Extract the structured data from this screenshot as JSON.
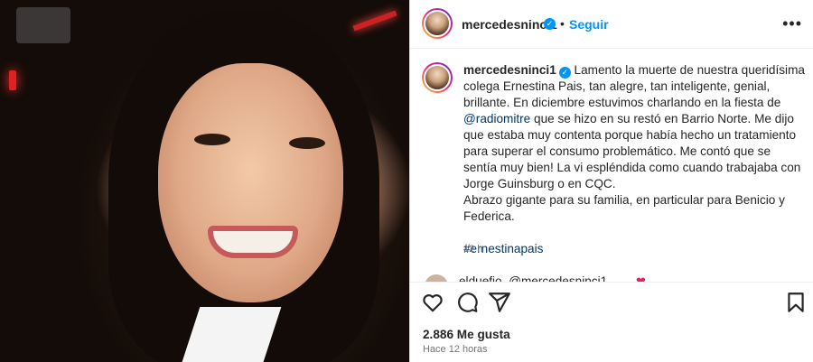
{
  "post": {
    "username": "mercedesninci1",
    "follow_label": "Seguir",
    "more_label": "•••",
    "dot": "•",
    "verified_mark": "✓"
  },
  "caption": {
    "username": "mercedesninci1",
    "text_before_mention": "Lamento la muerte de nuestra queridísima colega Ernestina Pais, tan alegre, tan inteligente, genial, brillante. En diciembre estuvimos charlando en la fiesta de",
    "mention": "@radiomitre",
    "text_after_mention": "que se hizo en su restó en Barrio Norte. Me dijo que estaba muy contenta porque había hecho un tratamiento para superar el consumo problemático. Me contó que se sentía muy bien! La vi espléndida como cuando trabajaba con Jorge Guinsburg o en CQC.",
    "closing": "Abrazo gigante para su familia, en particular para Benicio y Federica.",
    "hashtag": "#ernestinapais",
    "time_ago": "12 h"
  },
  "comment_peek": {
    "text": "elduefio. @mercedesninci1",
    "heart": "❤"
  },
  "actions": {
    "like_icon": "heart-outline-icon",
    "comment_icon": "speech-bubble-icon",
    "share_icon": "paper-plane-icon",
    "save_icon": "bookmark-icon"
  },
  "stats": {
    "likes": "2.886 Me gusta",
    "posted": "Hace 12 horas"
  },
  "colors": {
    "accent": "#0095f6",
    "link": "#00376b",
    "muted": "#737373",
    "text": "#262626"
  }
}
